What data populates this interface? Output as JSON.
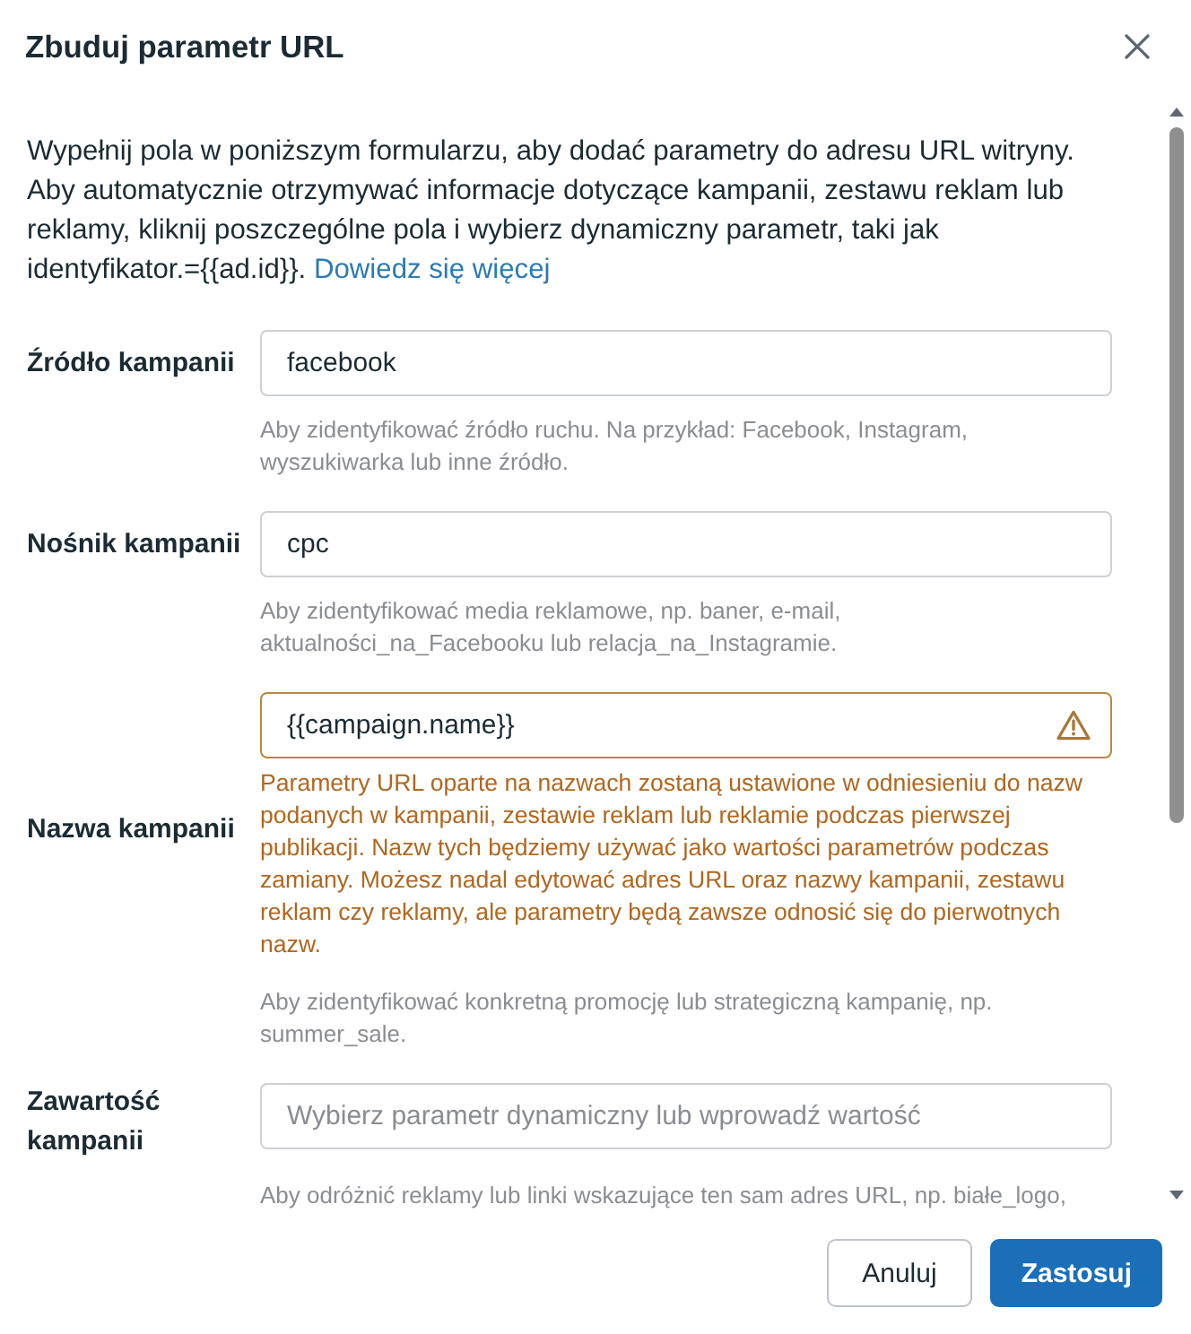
{
  "dialog": {
    "title": "Zbuduj parametr URL"
  },
  "intro": {
    "text": "Wypełnij pola w poniższym formularzu, aby dodać parametry do adresu URL witryny. Aby automatycznie otrzymywać informacje dotyczące kampanii, zestawu reklam lub reklamy, kliknij poszczególne pola i wybierz dynamiczny parametr, taki jak identyfikator.={{ad.id}}.",
    "link": "Dowiedz się więcej"
  },
  "fields": [
    {
      "label": "Źródło kampanii",
      "value": "facebook",
      "helper": "Aby zidentyfikować źródło ruchu. Na przykład: Facebook, Instagram, wyszukiwarka lub inne źródło."
    },
    {
      "label": "Nośnik kampanii",
      "value": "cpc",
      "helper": "Aby zidentyfikować media reklamowe, np. baner, e-mail, aktualności_na_Facebooku lub relacja_na_Instagramie."
    },
    {
      "label": "Nazwa kampanii",
      "value": "{{campaign.name}}",
      "warning": "Parametry URL oparte na nazwach zostaną ustawione w odniesieniu do nazw podanych w kampanii, zestawie reklam lub reklamie podczas pierwszej publikacji. Nazw tych będziemy używać jako wartości parametrów podczas zamiany. Możesz nadal edytować adres URL oraz nazwy kampanii, zestawu reklam czy reklamy, ale parametry będą zawsze odnosić się do pierwotnych nazw.",
      "helper": "Aby zidentyfikować konkretną promocję lub strategiczną kampanię, np. summer_sale."
    },
    {
      "label": "Zawartość kampanii",
      "placeholder": "Wybierz parametr dynamiczny lub wprowadź wartość",
      "helper": "Aby odróżnić reklamy lub linki wskazujące ten sam adres URL, np. białe_logo,"
    }
  ],
  "buttons": [
    {
      "label": "Anuluj",
      "kind": "secondary"
    },
    {
      "label": "Zastosuj",
      "kind": "primary"
    }
  ]
}
